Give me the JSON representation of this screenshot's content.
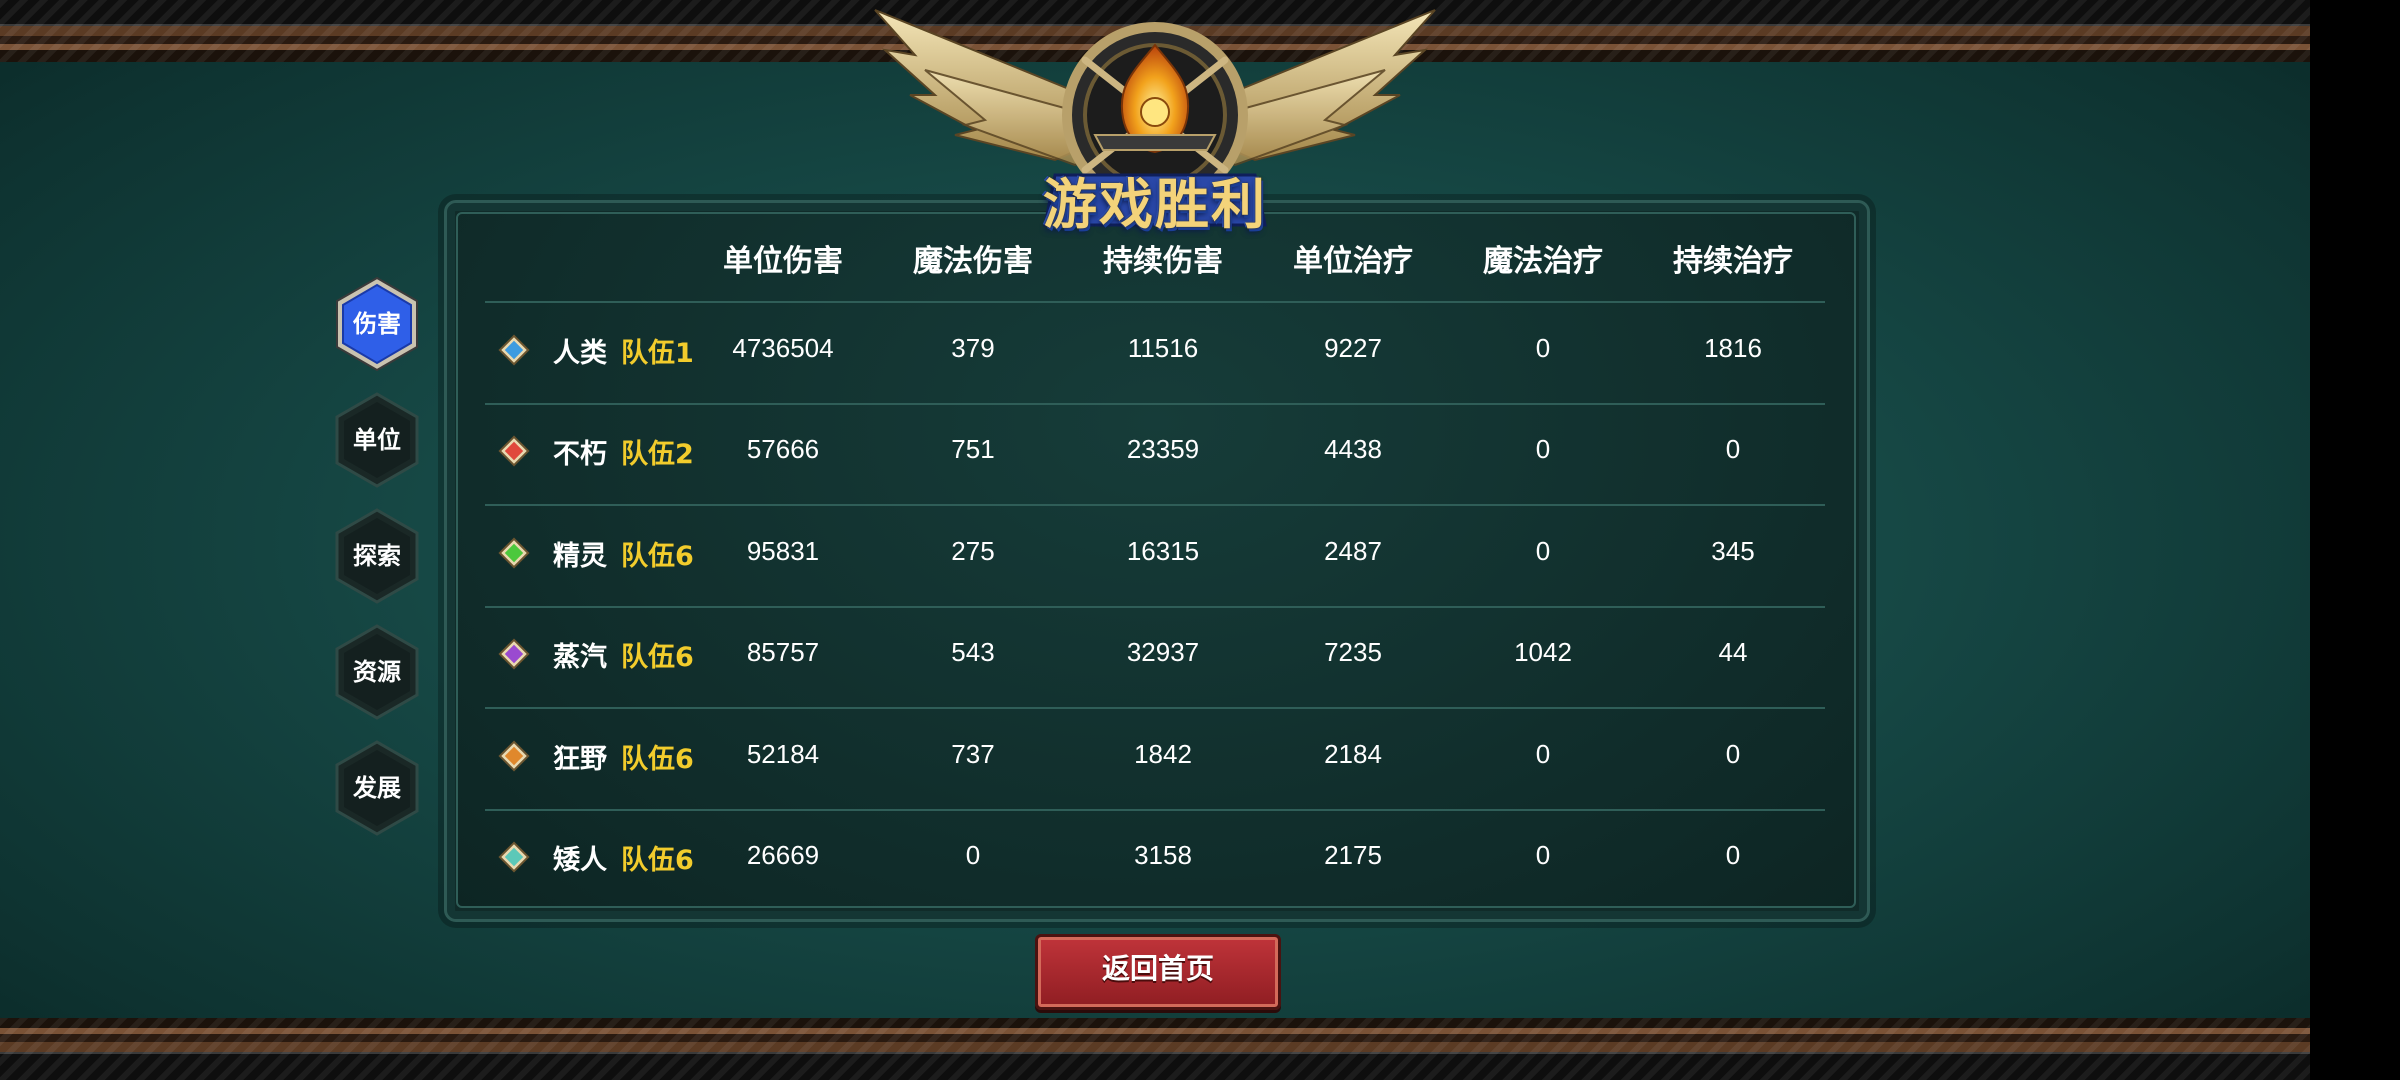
{
  "title": "游戏胜利",
  "tabs": [
    {
      "label": "伤害",
      "active": true
    },
    {
      "label": "单位",
      "active": false
    },
    {
      "label": "探索",
      "active": false
    },
    {
      "label": "资源",
      "active": false
    },
    {
      "label": "发展",
      "active": false
    }
  ],
  "columns": [
    "单位伤害",
    "魔法伤害",
    "持续伤害",
    "单位治疗",
    "魔法治疗",
    "持续治疗"
  ],
  "rows": [
    {
      "race": "人类",
      "team": "队伍1",
      "gem_color": "#3d9be0",
      "values": [
        "4736504",
        "379",
        "11516",
        "9227",
        "0",
        "1816"
      ]
    },
    {
      "race": "不朽",
      "team": "队伍2",
      "gem_color": "#e0483c",
      "values": [
        "57666",
        "751",
        "23359",
        "4438",
        "0",
        "0"
      ]
    },
    {
      "race": "精灵",
      "team": "队伍6",
      "gem_color": "#4cc83c",
      "values": [
        "95831",
        "275",
        "16315",
        "2487",
        "0",
        "345"
      ]
    },
    {
      "race": "蒸汽",
      "team": "队伍6",
      "gem_color": "#9a4ad0",
      "values": [
        "85757",
        "543",
        "32937",
        "7235",
        "1042",
        "44"
      ]
    },
    {
      "race": "狂野",
      "team": "队伍6",
      "gem_color": "#e0882c",
      "values": [
        "52184",
        "737",
        "1842",
        "2184",
        "0",
        "0"
      ]
    },
    {
      "race": "矮人",
      "team": "队伍6",
      "gem_color": "#5cc8b8",
      "values": [
        "26669",
        "0",
        "3158",
        "2175",
        "0",
        "0"
      ]
    }
  ],
  "return_button": "返回首页",
  "colors": {
    "team_text": "#f2cc2c",
    "active_tab": "#2f5fe8",
    "button": "#b02a30"
  }
}
